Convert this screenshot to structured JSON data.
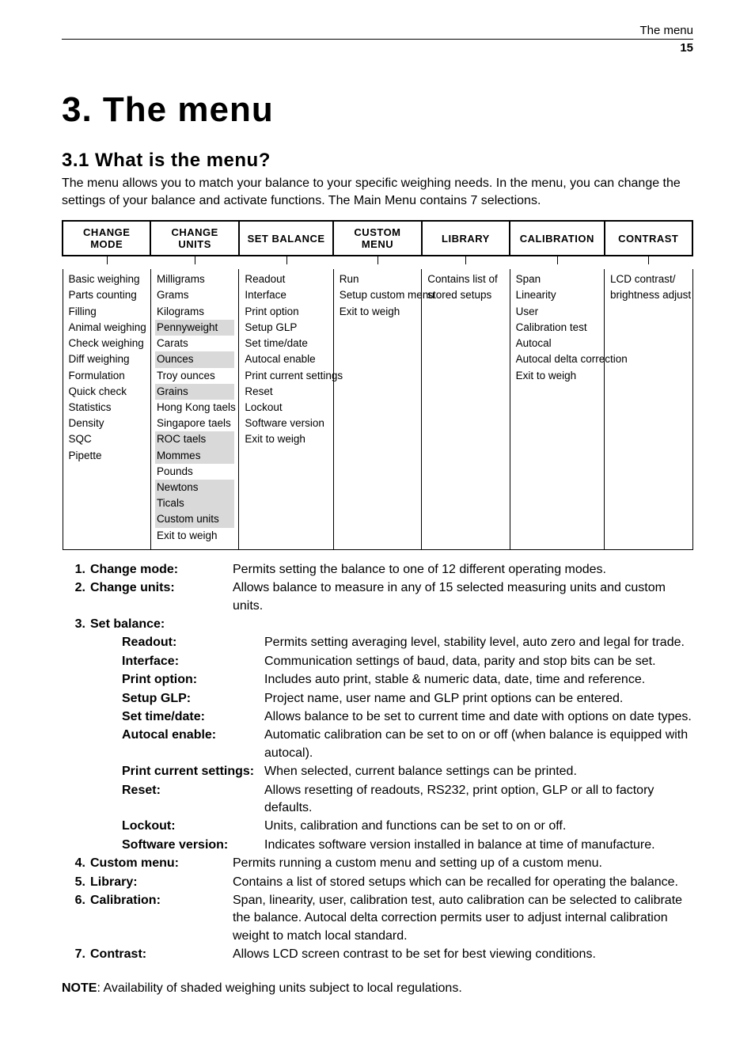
{
  "header": {
    "running": "The menu",
    "page_no": "15"
  },
  "chapter_title": "3.  The menu",
  "section_title": "3.1  What is the menu?",
  "intro": "The menu allows you to match your balance to your specific weighing needs. In the menu, you can change the settings of your balance and activate functions. The Main Menu contains 7 selections.",
  "menus": {
    "change_mode": {
      "head": "CHANGE MODE",
      "items": [
        {
          "t": "Basic weighing"
        },
        {
          "t": "Parts counting"
        },
        {
          "t": "Filling"
        },
        {
          "t": "Animal weighing"
        },
        {
          "t": "Check weighing"
        },
        {
          "t": "Diff weighing"
        },
        {
          "t": "Formulation"
        },
        {
          "t": "Quick check"
        },
        {
          "t": "Statistics"
        },
        {
          "t": "Density"
        },
        {
          "t": "SQC"
        },
        {
          "t": "Pipette"
        }
      ]
    },
    "change_units": {
      "head": "CHANGE UNITS",
      "items": [
        {
          "t": "Milligrams"
        },
        {
          "t": "Grams"
        },
        {
          "t": "Kilograms"
        },
        {
          "t": "Pennyweight",
          "shaded": true
        },
        {
          "t": "Carats"
        },
        {
          "t": "Ounces",
          "shaded": true
        },
        {
          "t": "Troy ounces"
        },
        {
          "t": "Grains",
          "shaded": true
        },
        {
          "t": "Hong Kong taels"
        },
        {
          "t": "Singapore taels"
        },
        {
          "t": "ROC taels",
          "shaded": true
        },
        {
          "t": "Mommes",
          "shaded": true
        },
        {
          "t": "Pounds"
        },
        {
          "t": "Newtons",
          "shaded": true
        },
        {
          "t": "Ticals",
          "shaded": true
        },
        {
          "t": "Custom units",
          "shaded": true
        },
        {
          "t": "Exit to weigh"
        }
      ]
    },
    "set_balance": {
      "head": "SET BALANCE",
      "items": [
        {
          "t": "Readout"
        },
        {
          "t": "Interface"
        },
        {
          "t": "Print option"
        },
        {
          "t": "Setup GLP"
        },
        {
          "t": "Set time/date"
        },
        {
          "t": "Autocal enable"
        },
        {
          "t": "Print current settings"
        },
        {
          "t": "Reset"
        },
        {
          "t": "Lockout"
        },
        {
          "t": "Software version"
        },
        {
          "t": "Exit to weigh"
        }
      ]
    },
    "custom_menu": {
      "head": "CUSTOM MENU",
      "items": [
        {
          "t": "Run"
        },
        {
          "t": "Setup custom menu"
        },
        {
          "t": "Exit to weigh"
        }
      ]
    },
    "library": {
      "head": "LIBRARY",
      "items": [
        {
          "t": "Contains list of"
        },
        {
          "t": "stored setups"
        }
      ]
    },
    "calibration": {
      "head": "CALIBRATION",
      "items": [
        {
          "t": "Span"
        },
        {
          "t": "Linearity"
        },
        {
          "t": "User"
        },
        {
          "t": "Calibration test"
        },
        {
          "t": "Autocal"
        },
        {
          "t": "Autocal delta correction"
        },
        {
          "t": "Exit to weigh"
        }
      ]
    },
    "contrast": {
      "head": "CONTRAST",
      "items": [
        {
          "t": "LCD contrast/"
        },
        {
          "t": "brightness adjust"
        }
      ]
    }
  },
  "definitions": [
    {
      "num": "1.",
      "label": "Change mode:",
      "desc": "Permits setting the balance to one of 12 different operating modes."
    },
    {
      "num": "2.",
      "label": "Change units:",
      "desc": "Allows balance to measure in any of 15 selected measuring units and custom units."
    },
    {
      "num": "3.",
      "label": "Set balance:",
      "desc": ""
    },
    {
      "sub": true,
      "label": "Readout:",
      "desc": "Permits setting averaging level, stability level, auto zero and legal for trade."
    },
    {
      "sub": true,
      "label": "Interface:",
      "desc": "Communication settings of baud, data, parity and stop bits can be set."
    },
    {
      "sub": true,
      "label": "Print option:",
      "desc": "Includes auto print, stable & numeric data, date, time and reference."
    },
    {
      "sub": true,
      "label": "Setup GLP:",
      "desc": "Project name, user name and GLP print options can be entered."
    },
    {
      "sub": true,
      "label": "Set time/date:",
      "desc": "Allows balance to be set to current time and date with options on date types."
    },
    {
      "sub": true,
      "label": "Autocal enable:",
      "desc": "Automatic calibration can be set to on or off (when balance is equipped with autocal)."
    },
    {
      "sub": true,
      "label": "Print current settings:",
      "desc": "When selected, current balance settings can be printed."
    },
    {
      "sub": true,
      "label": "Reset:",
      "desc": "Allows resetting of readouts, RS232, print option, GLP or all to factory defaults."
    },
    {
      "sub": true,
      "label": "Lockout:",
      "desc": "Units, calibration and functions can be set to on or off."
    },
    {
      "sub": true,
      "label": "Software version:",
      "desc": "Indicates software version installed in balance at time of manufacture."
    },
    {
      "num": "4.",
      "label": "Custom menu:",
      "desc": "Permits running a custom menu and setting up of a custom menu."
    },
    {
      "num": "5.",
      "label": "Library:",
      "desc": "Contains a list of stored setups which can be recalled for operating the balance."
    },
    {
      "num": "6.",
      "label": "Calibration:",
      "desc": "Span, linearity, user, calibration test, auto calibration can be selected to calibrate the balance. Autocal delta correction permits user to adjust internal calibration weight to match local standard."
    },
    {
      "num": "7.",
      "label": "Contrast:",
      "desc": "Allows LCD screen contrast to be set for best viewing conditions."
    }
  ],
  "note": {
    "label": "NOTE",
    "text": ": Availability of shaded weighing units subject to local regulations."
  }
}
